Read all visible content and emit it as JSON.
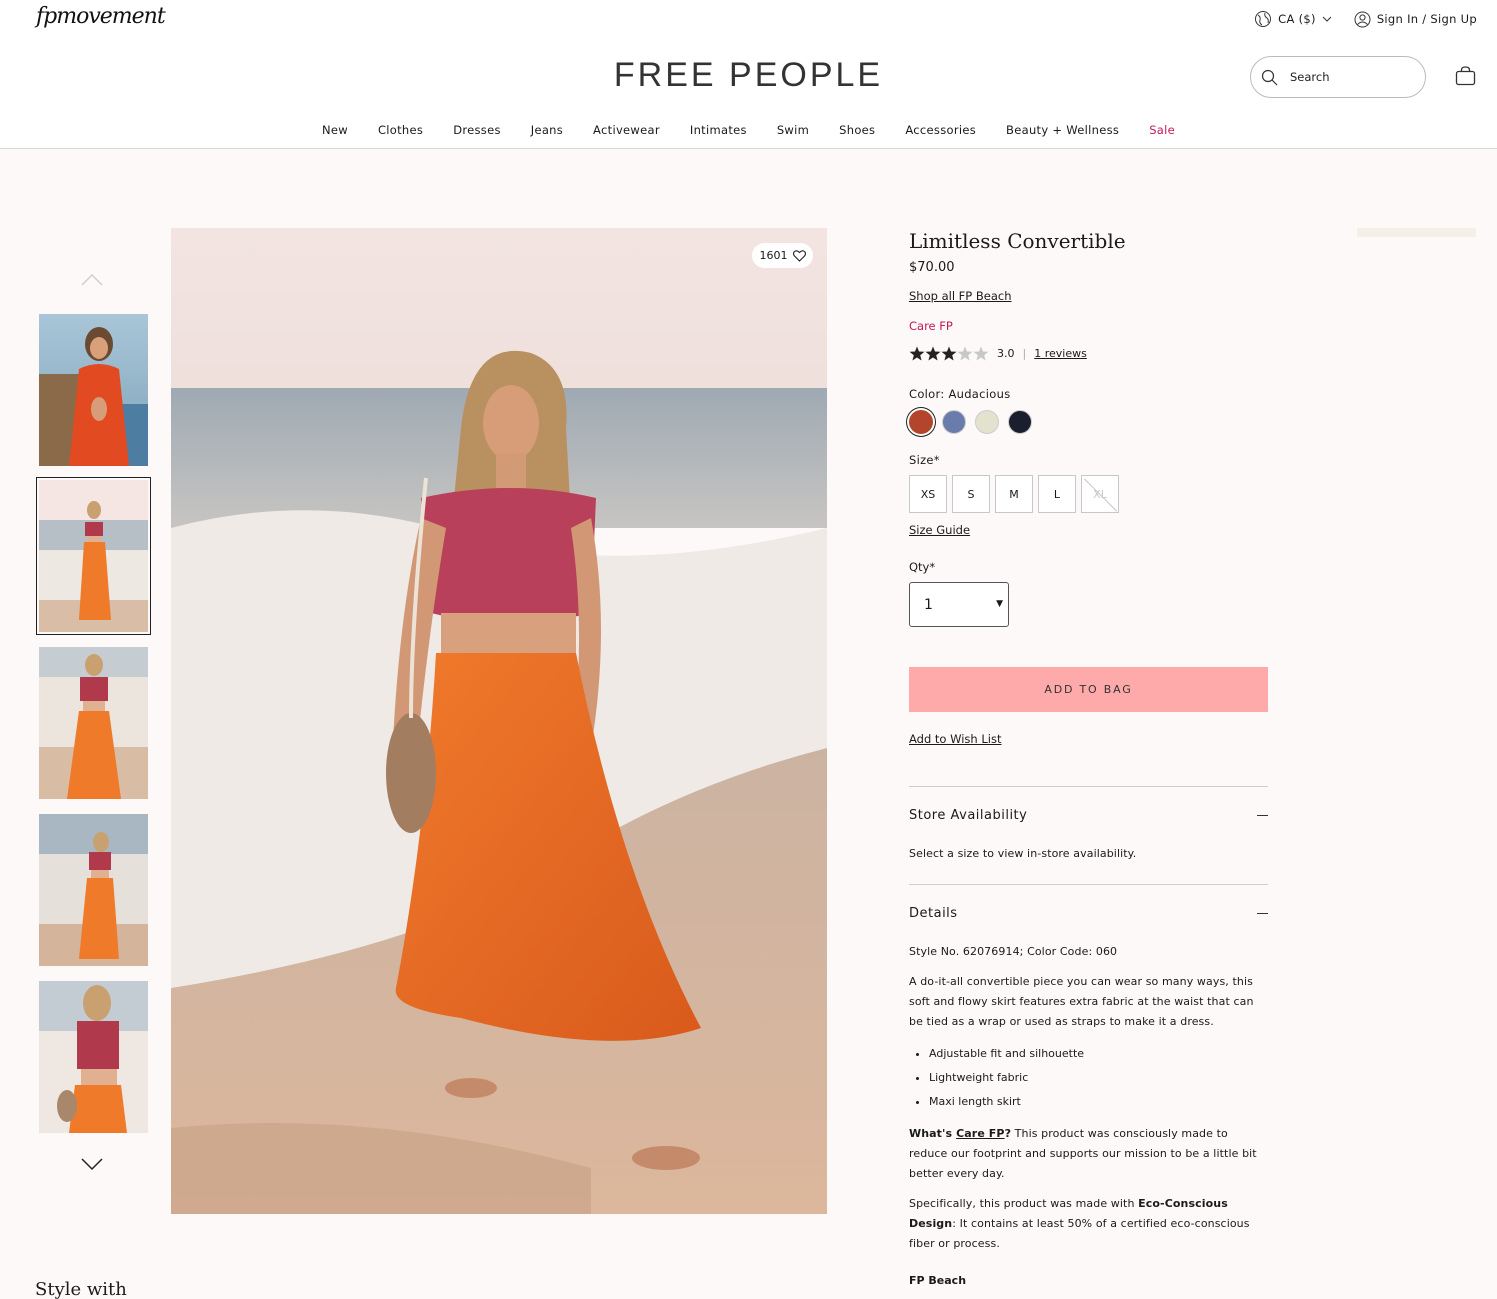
{
  "header": {
    "sub_brand": "fpmovement",
    "region": "CA ($)",
    "sign_in": "Sign In / Sign Up",
    "brand": "FREE PEOPLE",
    "search_placeholder": "Search",
    "nav": [
      "New",
      "Clothes",
      "Dresses",
      "Jeans",
      "Activewear",
      "Intimates",
      "Swim",
      "Shoes",
      "Accessories",
      "Beauty + Wellness",
      "Sale"
    ]
  },
  "gallery": {
    "likes": "1601",
    "thumbnail_count": 5,
    "active_thumbnail": 1
  },
  "product": {
    "title": "Limitless Convertible",
    "price": "$70.00",
    "shop_all": "Shop all FP Beach",
    "care": "Care FP",
    "rating": "3.0",
    "rating_value": 3,
    "rating_max": 5,
    "reviews": "1 reviews",
    "color_label": "Color: Audacious",
    "colors": [
      "#b2452c",
      "#6a7cab",
      "#e2e2cf",
      "#1b1e2d"
    ],
    "size_label": "Size*",
    "sizes": [
      "XS",
      "S",
      "M",
      "L",
      "XL"
    ],
    "size_guide": "Size Guide",
    "qty_label": "Qty*",
    "qty_value": "1",
    "add_to_bag": "ADD TO BAG",
    "wishlist": "Add to Wish List"
  },
  "store": {
    "title": "Store Availability",
    "text": "Select a size to view in-store availability."
  },
  "details": {
    "title": "Details",
    "style": "Style No. 62076914; Color Code: 060",
    "description": "A do-it-all convertible piece you can wear so many ways, this soft and flowy skirt features extra fabric at the waist that can be tied as a wrap or used as straps to make it a dress.",
    "bullets": [
      "Adjustable fit and silhouette",
      "Lightweight fabric",
      "Maxi length skirt"
    ],
    "care_q_prefix": "What's ",
    "care_q_link": "Care FP",
    "care_q_mark": "?",
    "care_answer": " This product was consciously made to reduce our footprint and supports our mission to be a little bit better every day.",
    "eco_prefix": "Specifically, this product was made with ",
    "eco_bold": "Eco-Conscious Design",
    "eco_suffix": ": It contains at least 50% of a certified eco-conscious fiber or process.",
    "collection": "FP Beach"
  },
  "style_with": "Style with",
  "colors": {
    "sale": "#c2185b",
    "add_bag_bg": "#ffaaaa",
    "page_bg": "#fdf9f8"
  }
}
